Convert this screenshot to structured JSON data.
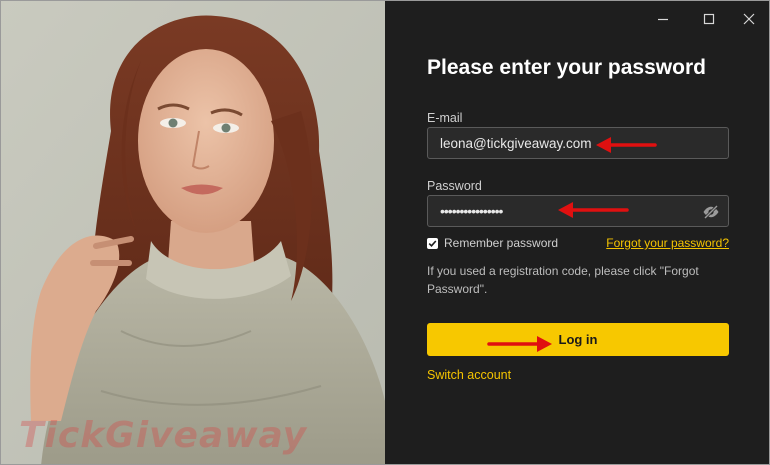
{
  "photo": {
    "description_icon": "portrait-photo",
    "watermark": "TickGiveaway"
  },
  "window_controls": {
    "minimize_icon": "minimize-icon",
    "maximize_icon": "maximize-icon",
    "close_icon": "close-icon"
  },
  "form": {
    "title": "Please enter your password",
    "email_label": "E-mail",
    "email_value": "leona@tickgiveaway.com",
    "password_label": "Password",
    "password_value": "••••••••••••••••",
    "remember_label": "Remember password",
    "remember_checked": true,
    "forgot_link": "Forgot your password?",
    "info_text": "If you used a registration code, please click \"Forgot Password\".",
    "login_button": "Log in",
    "switch_account": "Switch account"
  },
  "colors": {
    "accent": "#f7c800",
    "panel_bg": "#1e1e1e",
    "annotation_arrow": "#e01010"
  }
}
